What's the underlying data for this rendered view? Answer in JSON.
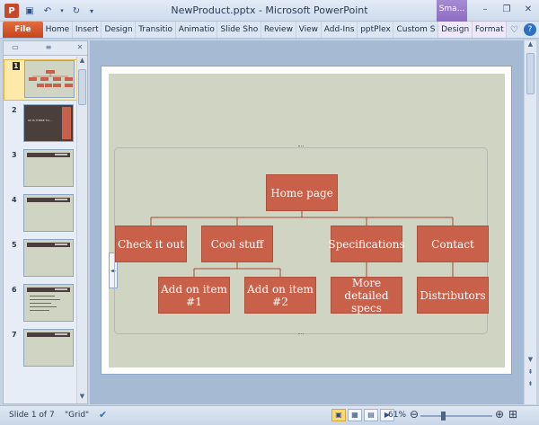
{
  "window": {
    "title": "NewProduct.pptx - Microsoft PowerPoint",
    "contextual_tab": "Sma...",
    "app_icon_letter": "P"
  },
  "ribbon": {
    "file_label": "File",
    "tabs": [
      "Home",
      "Insert",
      "Design",
      "Transitio",
      "Animatio",
      "Slide Sho",
      "Review",
      "View",
      "Add-Ins",
      "pptPlex",
      "Custom S",
      "Design",
      "Format"
    ]
  },
  "slides_panel": {
    "slide_numbers": [
      "1",
      "2",
      "3",
      "4",
      "5",
      "6",
      "7"
    ],
    "slide2_text": "UP IS THERE TO..."
  },
  "smartart": {
    "root": "Home page",
    "level1": [
      "Check it out",
      "Cool stuff",
      "Specifications",
      "Contact"
    ],
    "level2": [
      "Add on item #1",
      "Add on item #2",
      "More detailed specs",
      "Distributors"
    ]
  },
  "status": {
    "slide_info": "Slide 1 of 7",
    "theme": "\"Grid\"",
    "zoom": "61%",
    "zoom_level": 0.61
  },
  "colors": {
    "node_fill": "#c8604a",
    "slide_bg": "#cfd5c2",
    "connector": "#a24a3a"
  }
}
